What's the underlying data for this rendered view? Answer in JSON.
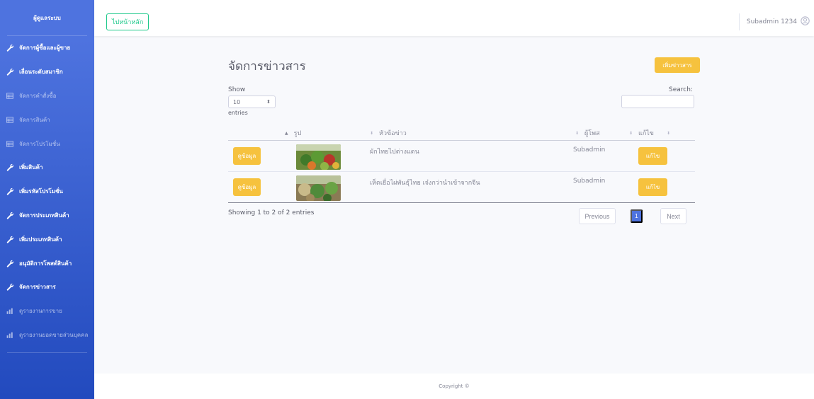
{
  "sidebar": {
    "brand": "ผู้ดูแลระบบ",
    "items": [
      {
        "label": "จัดการผู้ซื้อและผู้ขาย",
        "icon": "wrench-icon",
        "style": "bold"
      },
      {
        "label": "เลื่อนระดับสมาชิก",
        "icon": "wrench-icon",
        "style": "bold"
      },
      {
        "label": "จัดการคำสั่งซื้อ",
        "icon": "table-icon",
        "style": "dim"
      },
      {
        "label": "จัดการสินค้า",
        "icon": "table-icon",
        "style": "dim"
      },
      {
        "label": "จัดการโปรโมชั่น",
        "icon": "table-icon",
        "style": "dim"
      },
      {
        "label": "เพิ่มสินค้า",
        "icon": "wrench-icon",
        "style": "bold"
      },
      {
        "label": "เพิ่มรหัสโปรโมชั่น",
        "icon": "wrench-icon",
        "style": "bold"
      },
      {
        "label": "จัดการประเภทสินค้า",
        "icon": "wrench-icon",
        "style": "bold"
      },
      {
        "label": "เพิ่มประเภทสินค้า",
        "icon": "wrench-icon",
        "style": "bold"
      },
      {
        "label": "อนุมัติการโพสต์สินค้า",
        "icon": "wrench-icon",
        "style": "bold"
      },
      {
        "label": "จัดการข่าวสาร",
        "icon": "wrench-icon",
        "style": "bold"
      },
      {
        "label": "ดูรายงานการขาย",
        "icon": "chart-icon",
        "style": "dim"
      },
      {
        "label": "ดูรายงานยอดขายส่วนบุคคล",
        "icon": "chart-icon",
        "style": "dim"
      }
    ]
  },
  "topbar": {
    "home_label": "ไปหน้าหลัก",
    "user_name": "Subadmin 1234",
    "user_icon": "user-circle-icon"
  },
  "page": {
    "title": "จัดการข่าวสาร",
    "add_button": "เพิ่มข่าวสาร"
  },
  "table_controls": {
    "show_label": "Show",
    "length_value": "10",
    "entries_label": "entries",
    "search_label": "Search:",
    "search_value": ""
  },
  "table": {
    "columns": [
      "รูป",
      "หัวข้อข่าว",
      "ผู้โพส",
      "แก้ไข"
    ],
    "rows": [
      {
        "view": "ดูข้อมูล",
        "headline": "ผักไทยไปต่างแดน",
        "poster": "Subadmin",
        "edit": "แก้ไข"
      },
      {
        "view": "ดูข้อมูล",
        "headline": "เห็ดเยื่อไผ่พันธุ์ไทย เจ๋งกว่านำเข้าจากจีน",
        "poster": "Subadmin",
        "edit": "แก้ไข"
      }
    ]
  },
  "pagination": {
    "info": "Showing 1 to 2 of 2 entries",
    "previous": "Previous",
    "current": "1",
    "next": "Next"
  },
  "footer": {
    "copyright": "Copyright ©"
  },
  "colors": {
    "sidebar": "#4e73df",
    "warning": "#f6c23e",
    "success": "#1cc88a",
    "primary": "#4e73df"
  }
}
